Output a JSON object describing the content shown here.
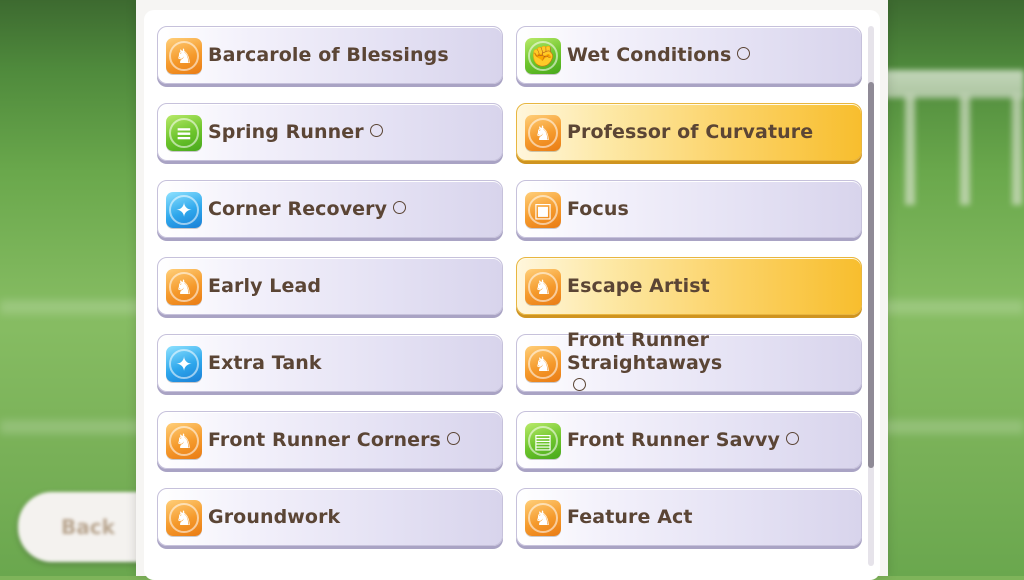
{
  "back_label": "Back",
  "skills": [
    {
      "name": "Barcarole of Blessings",
      "icon": "running-horse-icon",
      "icon_color": "orange",
      "rarity": "normal",
      "circle": false
    },
    {
      "name": "Wet Conditions",
      "icon": "muscle-arm-icon",
      "icon_color": "green",
      "rarity": "normal",
      "circle": true
    },
    {
      "name": "Spring Runner",
      "icon": "speed-lines-icon",
      "icon_color": "green",
      "rarity": "normal",
      "circle": true
    },
    {
      "name": "Professor of Curvature",
      "icon": "running-horse-icon",
      "icon_color": "orange",
      "rarity": "gold",
      "circle": false
    },
    {
      "name": "Corner Recovery",
      "icon": "sparkle-icon",
      "icon_color": "blue",
      "rarity": "normal",
      "circle": true
    },
    {
      "name": "Focus",
      "icon": "starting-gate-icon",
      "icon_color": "orange",
      "rarity": "normal",
      "circle": false
    },
    {
      "name": "Early Lead",
      "icon": "running-horse-icon",
      "icon_color": "orange",
      "rarity": "normal",
      "circle": false
    },
    {
      "name": "Escape Artist",
      "icon": "running-horse-icon",
      "icon_color": "orange",
      "rarity": "gold",
      "circle": false
    },
    {
      "name": "Extra Tank",
      "icon": "sparkle-icon",
      "icon_color": "blue",
      "rarity": "normal",
      "circle": false
    },
    {
      "name": "Front Runner Straightaways",
      "icon": "running-horse-icon",
      "icon_color": "orange",
      "rarity": "normal",
      "circle": true
    },
    {
      "name": "Front Runner Corners",
      "icon": "running-horse-icon",
      "icon_color": "orange",
      "rarity": "normal",
      "circle": true
    },
    {
      "name": "Front Runner Savvy",
      "icon": "notebook-icon",
      "icon_color": "green",
      "rarity": "normal",
      "circle": true
    },
    {
      "name": "Groundwork",
      "icon": "running-horse-icon",
      "icon_color": "orange",
      "rarity": "normal",
      "circle": false
    },
    {
      "name": "Feature Act",
      "icon": "running-horse-icon",
      "icon_color": "orange",
      "rarity": "normal",
      "circle": false
    }
  ]
}
